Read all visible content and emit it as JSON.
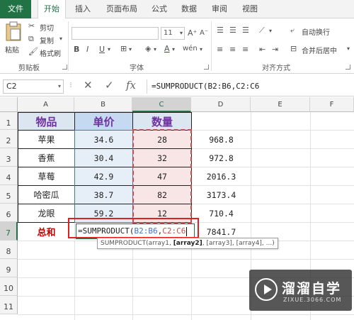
{
  "tabs": [
    "文件",
    "开始",
    "插入",
    "页面布局",
    "公式",
    "数据",
    "审阅",
    "视图"
  ],
  "ribbon": {
    "paste_label": "粘贴",
    "cut_label": "剪切",
    "copy_label": "复制",
    "format_painter_label": "格式刷",
    "clipboard_group": "剪贴板",
    "font_size": "11",
    "font_group": "字体",
    "wrap_text_label": "自动换行",
    "merge_center_label": "合并后居中",
    "alignment_group": "对齐方式"
  },
  "formula_bar": {
    "name_box": "C2",
    "cancel_icon": "✕",
    "enter_icon": "✓",
    "fx_icon": "fx",
    "formula": "=SUMPRODUCT(B2:B6,C2:C6"
  },
  "columns": [
    "A",
    "B",
    "C",
    "D",
    "E",
    "F"
  ],
  "rows": [
    "1",
    "2",
    "3",
    "4",
    "5",
    "6",
    "7",
    "8",
    "9",
    "10",
    "11"
  ],
  "table": {
    "headers": [
      "物品",
      "单价",
      "数量"
    ],
    "items": [
      {
        "name": "苹果",
        "price": "34.6",
        "qty": "28",
        "total": "968.8"
      },
      {
        "name": "香蕉",
        "price": "30.4",
        "qty": "32",
        "total": "972.8"
      },
      {
        "name": "草莓",
        "price": "42.9",
        "qty": "47",
        "total": "2016.3"
      },
      {
        "name": "哈密瓜",
        "price": "38.7",
        "qty": "82",
        "total": "3173.4"
      },
      {
        "name": "龙眼",
        "price": "59.2",
        "qty": "12",
        "total": "710.4"
      }
    ],
    "total_label": "总和",
    "total_value": "7841.7"
  },
  "edit": {
    "prefix": "=SUMPRODUCT(",
    "range1": "B2:B6",
    "comma": ",",
    "range2": "C2:C6"
  },
  "tooltip": {
    "fn": "SUMPRODUCT(array1, ",
    "bold": "[array2]",
    "rest": ", [array3], [array4], ...)"
  },
  "watermark": {
    "title": "溜溜自学",
    "subtitle": "ZIXUE.3066.COM"
  },
  "colors": {
    "excel_green": "#217346",
    "header_purple": "#7030a0",
    "total_red": "#c00000",
    "range1_blue": "#4472c4",
    "range2_red": "#c0504d"
  }
}
